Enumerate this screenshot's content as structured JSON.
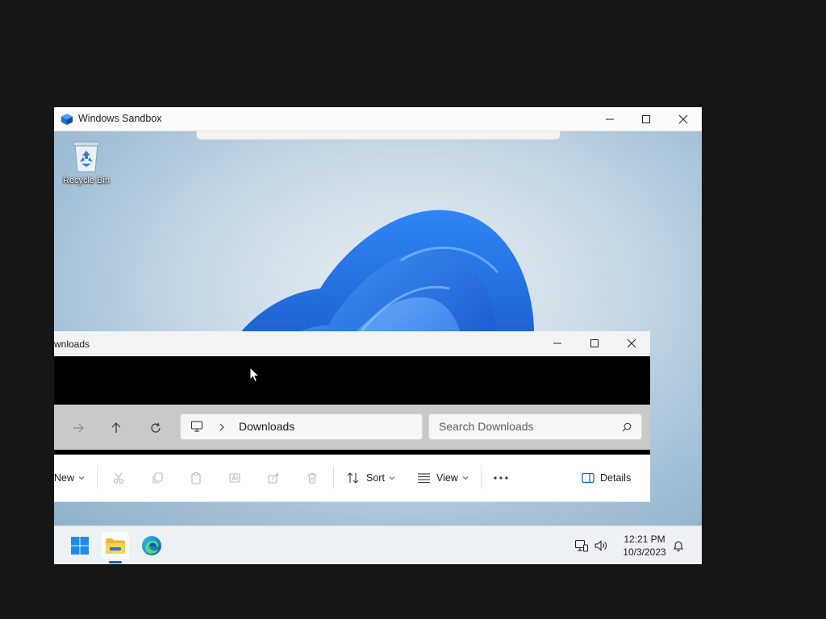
{
  "sandbox": {
    "title": "Windows Sandbox",
    "icons": {
      "logo": "sandbox-cube-icon",
      "minimize": "minimize-icon",
      "maximize": "maximize-icon",
      "close": "close-icon"
    }
  },
  "desktop": {
    "recycle_bin_label": "Recycle Bin",
    "wallpaper": "windows-11-bloom"
  },
  "explorer": {
    "title": "wnloads",
    "address": {
      "location": "Downloads"
    },
    "search": {
      "placeholder": "Search Downloads"
    },
    "toolbar": {
      "new_label": "New",
      "sort_label": "Sort",
      "view_label": "View",
      "details_label": "Details"
    }
  },
  "taskbar": {
    "time": "12:21 PM",
    "date": "10/3/2023"
  },
  "colors": {
    "accent": "#0067c0",
    "wallpaper_blue": "#1a66e0"
  }
}
